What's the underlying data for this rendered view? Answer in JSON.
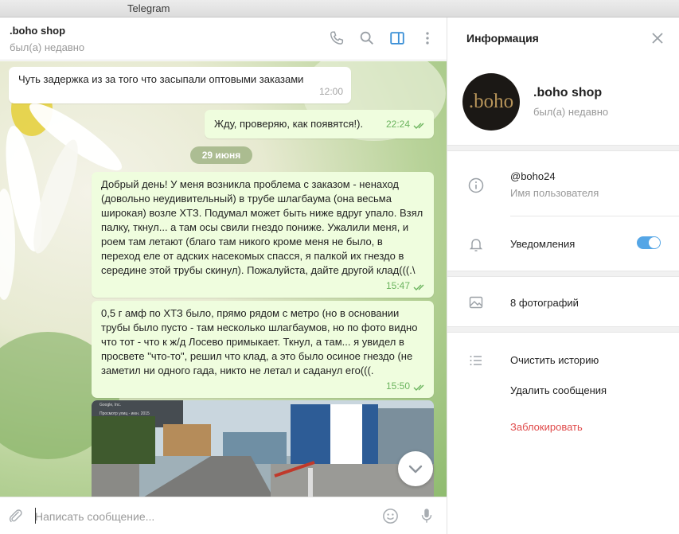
{
  "window": {
    "title": "Telegram"
  },
  "chat_header": {
    "name": ".boho shop",
    "status": "был(а) недавно",
    "icons": [
      "phone-icon",
      "search-icon",
      "sidebar-toggle-icon",
      "more-vertical-icon"
    ],
    "accent": "#3a8fd6"
  },
  "messages": [
    {
      "dir": "in",
      "text": "Чуть задержка из за того что засыпали оптовыми заказами",
      "time": "12:00"
    },
    {
      "dir": "out",
      "text": "Жду, проверяю, как появятся!).",
      "time": "22:24"
    },
    {
      "dir": "day",
      "text": "29 июня"
    },
    {
      "dir": "out",
      "text": "Добрый день! У меня возникла проблема с заказом - ненаход (довольно неудивительный) в трубе шлагбаума (она весьма широкая) возле ХТЗ. Подумал может быть ниже вдруг упало. Взял палку, ткнул... а там осы свили гнездо пониже. Ужалили меня, и роем там летают (благо там никого кроме меня не было, в переход еле от адских насекомых спасся, я палкой их гнездо в середине этой трубы скинул). Пожалуйста, дайте другой клад(((.\\",
      "time": "15:47"
    },
    {
      "dir": "out",
      "text": "0,5 г амф по ХТЗ было, прямо рядом с метро (но в основании трубы было пусто - там несколько шлагбаумов, но по фото видно что тот - что к ж/д Лосево примыкает. Ткнул, а там... я увидел в просвете \"что-то\", решил что клад, а это было осиное гнездо (не заметил ни одного гада, никто не летал и саданул его(((.",
      "time": "15:50"
    }
  ],
  "photo_labels": [
    "Google, Inc.",
    "Просмотр улиц - июн. 2015"
  ],
  "composer": {
    "placeholder": "Написать сообщение...",
    "icons": [
      "attach-icon",
      "emoji-icon",
      "microphone-icon"
    ]
  },
  "info_panel": {
    "header": "Информация",
    "avatar_text": ".boho",
    "name": ".boho shop",
    "status": "был(а) недавно",
    "username": "@boho24",
    "username_label": "Имя пользователя",
    "notifications_label": "Уведомления",
    "notifications_on": true,
    "photos_label": "8 фотографий",
    "clear_history": "Очистить историю",
    "delete_messages": "Удалить сообщения",
    "block": "Заблокировать",
    "danger_color": "#e04b4b",
    "toggle_color": "#55a6e6"
  }
}
